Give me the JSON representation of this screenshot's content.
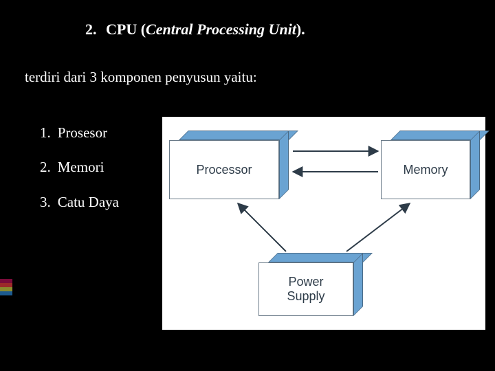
{
  "title": {
    "number": "2.",
    "prefix": "CPU (",
    "italic": "Central Processing Unit",
    "suffix": ")."
  },
  "subtitle": "terdiri dari 3 komponen penyusun yaitu:",
  "list": [
    {
      "num": "1.",
      "label": "Prosesor"
    },
    {
      "num": "2.",
      "label": "Memori"
    },
    {
      "num": "3.",
      "label": "Catu Daya"
    }
  ],
  "diagram": {
    "processor": "Processor",
    "memory": "Memory",
    "power": "Power\nSupply"
  },
  "accent_colors": [
    "#7a0b3a",
    "#9c2a2a",
    "#8b8b2e",
    "#1c5a8f"
  ]
}
